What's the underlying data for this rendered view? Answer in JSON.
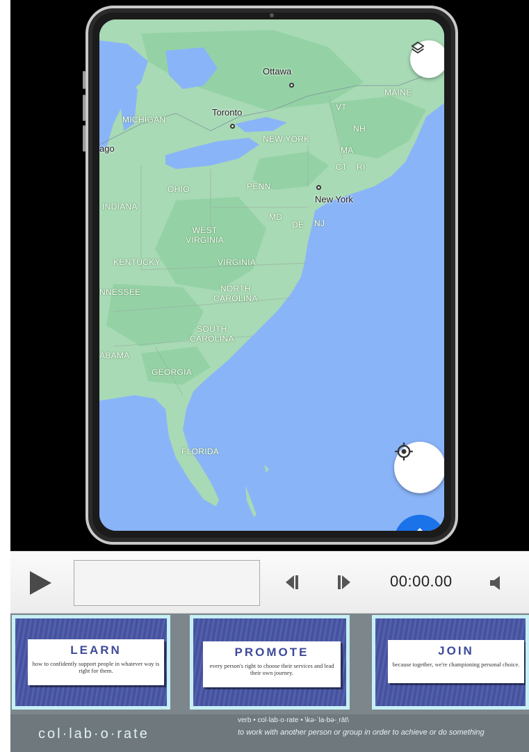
{
  "map": {
    "regions": {
      "michigan": "MICHIGAN",
      "maine": "MAINE",
      "vt": "VT",
      "nh": "NH",
      "new_york": "NEW YORK",
      "ma": "MA",
      "ct": "CT",
      "ri": "RI",
      "ohio": "OHIO",
      "penn": "PENN",
      "indiana": "INDIANA",
      "md": "MD",
      "de": "DE",
      "nj": "NJ",
      "west_virginia": "WEST\nVIRGINIA",
      "kentucky": "KENTUCKY",
      "virginia": "VIRGINIA",
      "tennessee": "NNESSEE",
      "north_carolina": "NORTH\nCAROLINA",
      "south_carolina": "SOUTH\nCAROLINA",
      "alabama": "ABAMA",
      "georgia": "GEORGIA",
      "florida": "FLORIDA"
    },
    "cities": {
      "ottawa": "Ottawa",
      "toronto": "Toronto",
      "chicago": "ago",
      "new_york": "New York"
    },
    "layers_icon": "layers-icon",
    "location_icon": "my-location-icon"
  },
  "player": {
    "time": "00:00.00",
    "play_icon": "play-icon",
    "step_back_icon": "step-back-icon",
    "step_forward_icon": "step-forward-icon",
    "volume_icon": "volume-icon"
  },
  "banner": {
    "cards": [
      {
        "title": "LEARN",
        "text": "how to confidently support people in whatever way is right for them."
      },
      {
        "title": "PROMOTE",
        "text": "every person's right to choose their services and lead their own journey."
      },
      {
        "title": "JOIN",
        "text": "because together, we're championing personal choice."
      }
    ],
    "word": "col·lab·o·rate",
    "definition_line1": "verb • col·lab·o·rate • \\kə-ˈla-bə-ˌrāt\\",
    "definition_line2": "to work with another person or group in order to achieve or do something"
  },
  "colors": {
    "water": "#8ab4f8",
    "land": "#a8dab5",
    "forest": "#94d2a5",
    "card_blue": "#4a57a8",
    "card_border": "#c6f0f5",
    "accent_blue": "#1a73e8"
  }
}
